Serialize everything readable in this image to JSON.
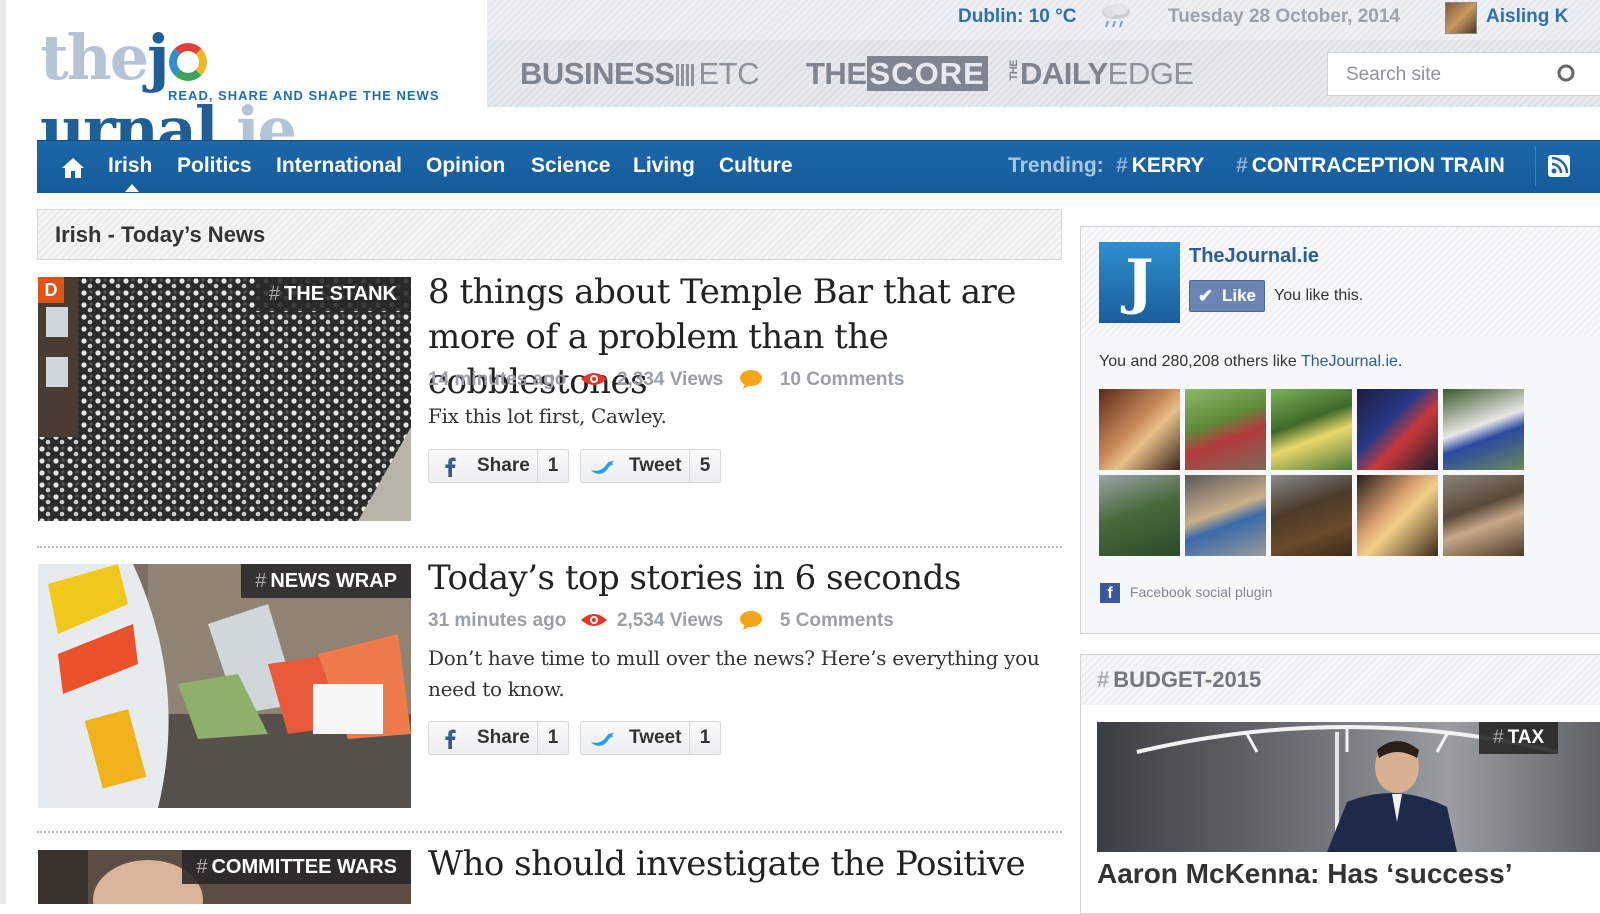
{
  "header": {
    "logo": {
      "part1": "the",
      "part2": "j",
      "part3": "urnal",
      "part4": ".ie",
      "tagline": "READ, SHARE AND SHAPE THE NEWS"
    },
    "weather": "Dublin: 10 °C",
    "weather_icon": "rain-cloud-icon",
    "date": "Tuesday 28 October, 2014",
    "user_name": "Aisling K",
    "sister_sites": {
      "business": {
        "bold": "BUSINESS",
        "light": "ETC"
      },
      "score": {
        "the": "THE",
        "score": "SCORE"
      },
      "daily": {
        "the": "THE",
        "bold": "DAILY",
        "light": "EDGE"
      }
    },
    "search": {
      "placeholder": "Search site"
    }
  },
  "nav": {
    "home_icon": "home-icon",
    "items": [
      "Irish",
      "Politics",
      "International",
      "Opinion",
      "Science",
      "Living",
      "Culture"
    ],
    "active": "Irish",
    "trending_label": "Trending:",
    "trending": [
      "KERRY",
      "CONTRACEPTION TRAIN"
    ],
    "hash": "#",
    "rss_icon": "rss-icon"
  },
  "section": {
    "title": "Irish - Today’s News"
  },
  "articles": [
    {
      "tag": "THE STANK",
      "badge": "D",
      "headline": "8 things about Temple Bar that are more of a problem than the cobblestones",
      "time": "14 minutes ago",
      "views": "2,334 Views",
      "comments": "10 Comments",
      "summary": "Fix this lot first, Cawley.",
      "share_label": "Share",
      "share_count": "1",
      "tweet_label": "Tweet",
      "tweet_count": "5"
    },
    {
      "tag": "NEWS WRAP",
      "headline": "Today’s top stories in 6 seconds",
      "time": "31 minutes ago",
      "views": "2,534 Views",
      "comments": "5 Comments",
      "summary": "Don’t have time to mull over the news? Here’s everything you need to know.",
      "share_label": "Share",
      "share_count": "1",
      "tweet_label": "Tweet",
      "tweet_count": "1"
    },
    {
      "tag": "COMMITTEE WARS",
      "headline": "Who should investigate the Positive"
    }
  ],
  "facebook": {
    "page_name": "TheJournal.ie",
    "logo_letter": "J",
    "like_label": "Like",
    "you_like": "You like this.",
    "count_prefix": "You and 280,208 others like ",
    "count_link": "TheJournal.ie",
    "count_suffix": ".",
    "plugin_label": "Facebook social plugin",
    "plugin_icon_letter": "f"
  },
  "budget": {
    "title": "BUDGET-2015",
    "tag": "TAX",
    "headline": "Aaron McKenna: Has ‘success’"
  },
  "colors": {
    "nav_blue": "#1d68ab",
    "link_blue": "#2d70b0",
    "view_red": "#e0362b",
    "comment_orange": "#f2a516",
    "facebook_blue": "#3b5998",
    "twitter_blue": "#2aa3dc"
  }
}
